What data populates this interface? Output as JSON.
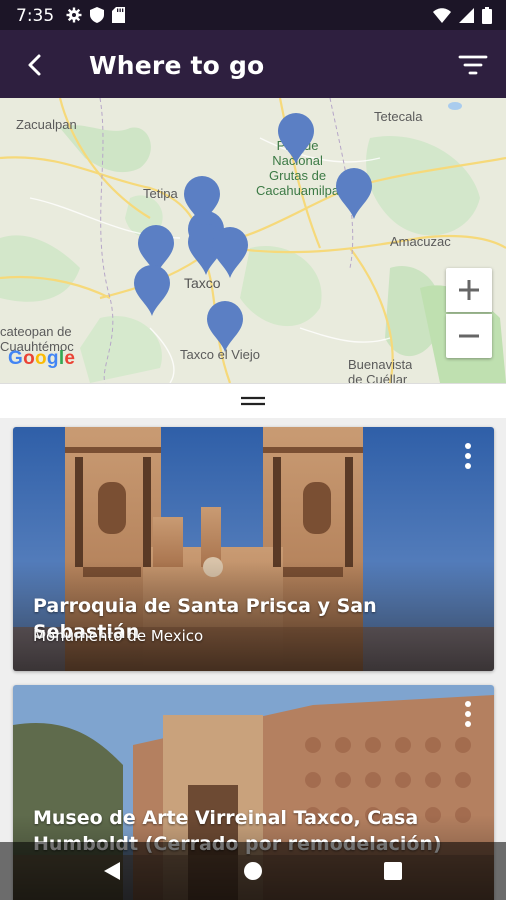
{
  "status_bar": {
    "time": "7:35",
    "left_icons": [
      "gear-icon",
      "shield-icon",
      "sd-card-icon"
    ],
    "right_icons": [
      "wifi-icon",
      "signal-icon",
      "battery-icon"
    ]
  },
  "app_bar": {
    "title": "Where to go",
    "back_icon": "back-arrow-icon",
    "filter_icon": "filter-icon",
    "background": "#2e1f3f"
  },
  "map": {
    "labels": {
      "zacualpan": "Zacualpan",
      "tetecala": "Tetecala",
      "park": "Parque\nNacional\nGrutas de\nCacahuamilpa",
      "tetipac": "Tetipa",
      "amacuzac": "Amacuzac",
      "taxco": "Taxco",
      "cateopan": "cateopan de\nCuauhtémoc",
      "taxco_viejo": "Taxco el Viejo",
      "buenavista": "Buenavista\nde Cuéllar"
    },
    "zoom_in": "+",
    "zoom_out": "−",
    "google_logo": "Google",
    "pin_color": "#5b7fc4"
  },
  "drawer": {
    "handle_icon": "drag-handle-icon"
  },
  "places": [
    {
      "name": "Parroquia de Santa Prisca y San Sebastián",
      "category": "Monumento de Mexico"
    },
    {
      "name": "Museo de Arte Virreinal Taxco, Casa Humboldt (Cerrado por remodelación)",
      "category": ""
    }
  ],
  "nav_bar": {
    "back_icon": "nav-back-icon",
    "home_icon": "nav-home-icon",
    "recents_icon": "nav-recents-icon"
  }
}
